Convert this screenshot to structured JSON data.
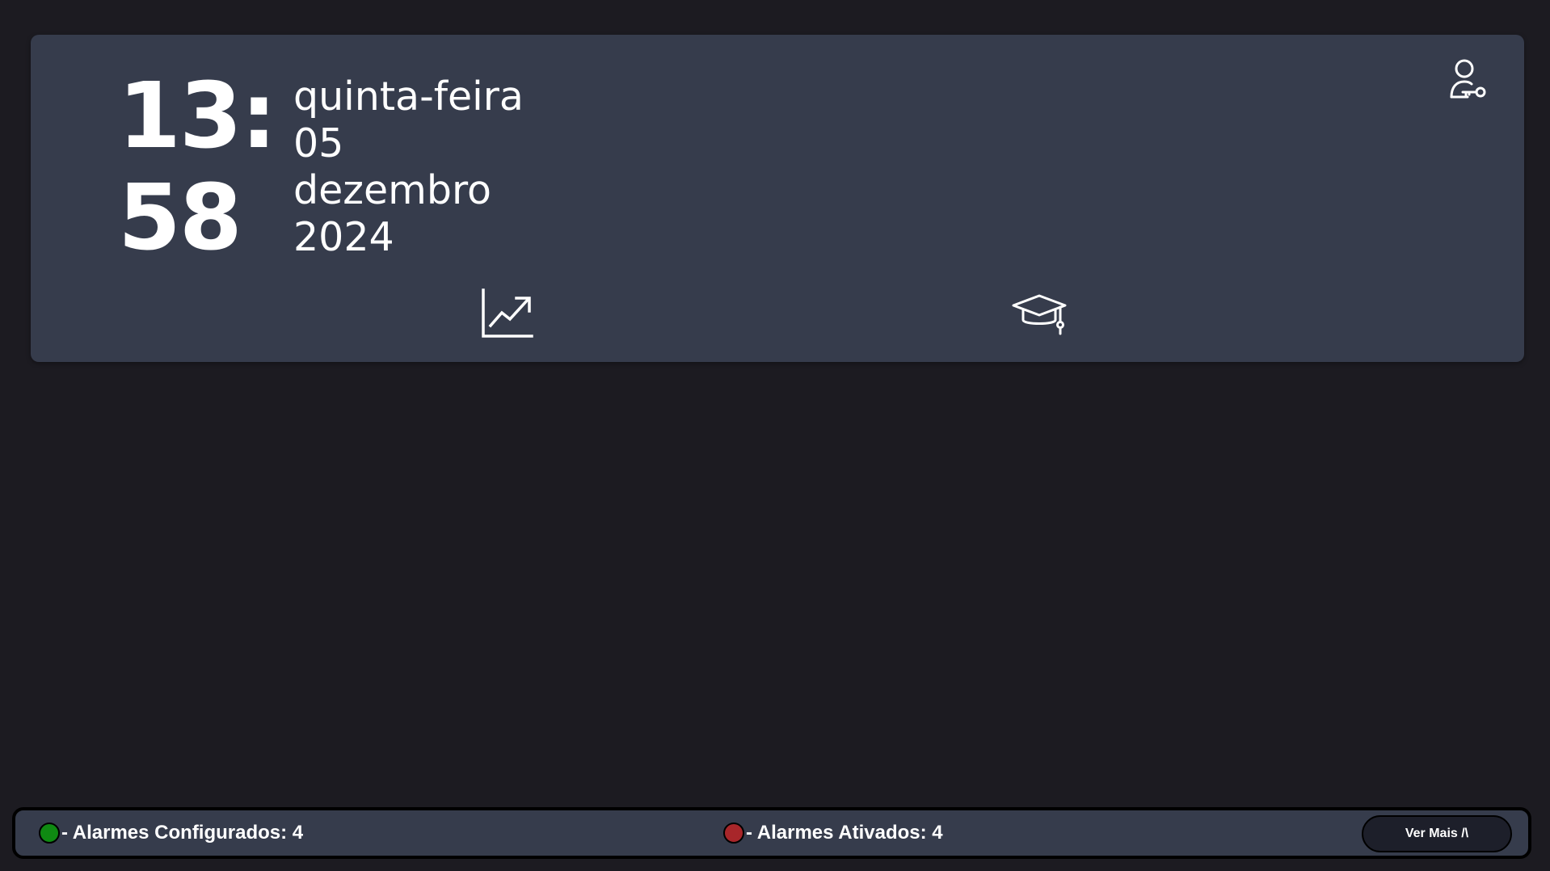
{
  "header": {
    "clock": {
      "hours": "13:",
      "minutes": "58"
    },
    "date": {
      "weekday": "quinta-feira",
      "day": "05",
      "month": "dezembro",
      "year": "2024"
    },
    "icons": {
      "user": "user-key-icon",
      "trends": "chart-line-up-icon",
      "training": "graduation-cap-icon"
    }
  },
  "footer": {
    "configured": {
      "label": "- Alarmes Configurados: 4",
      "color": "#0f8a12"
    },
    "active": {
      "label": "- Alarmes Ativados: 4",
      "color": "#a8262a"
    },
    "see_more_label": "Ver Mais /\\"
  },
  "colors": {
    "background": "#1c1b21",
    "card": "#363c4c",
    "text": "#ffffff"
  }
}
